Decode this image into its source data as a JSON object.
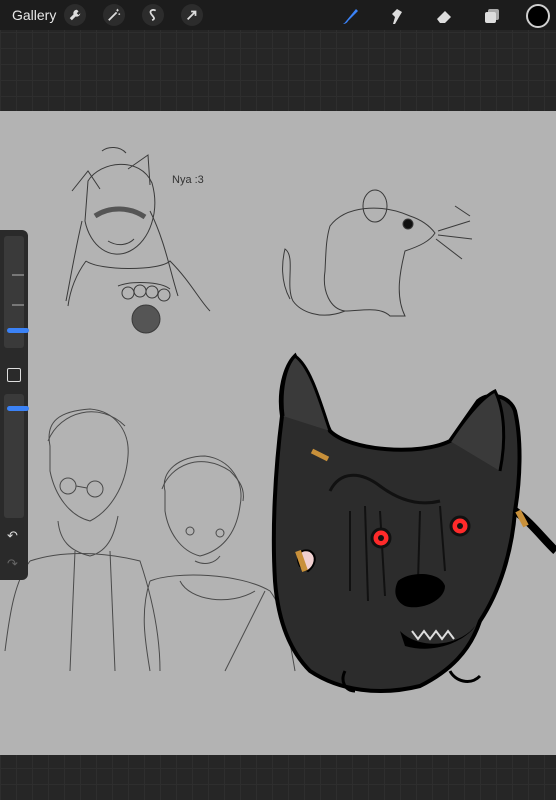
{
  "topbar": {
    "gallery_label": "Gallery",
    "left_tools": [
      "wrench-icon",
      "magic-wand-icon",
      "selection-icon",
      "transform-arrow-icon"
    ],
    "right_tools": [
      "brush-icon",
      "smudge-icon",
      "eraser-icon",
      "layers-icon"
    ],
    "active_tool": "brush-icon",
    "active_color": "#000000",
    "accent_color": "#3b82f6"
  },
  "canvas": {
    "background": "#b3b3b3",
    "annotation_text": "Nya :3"
  },
  "sidebar": {
    "size_slider_level": 0.2,
    "opacity_slider_level": 0.05,
    "undo_icon": "undo-icon",
    "redo_icon": "redo-icon"
  }
}
